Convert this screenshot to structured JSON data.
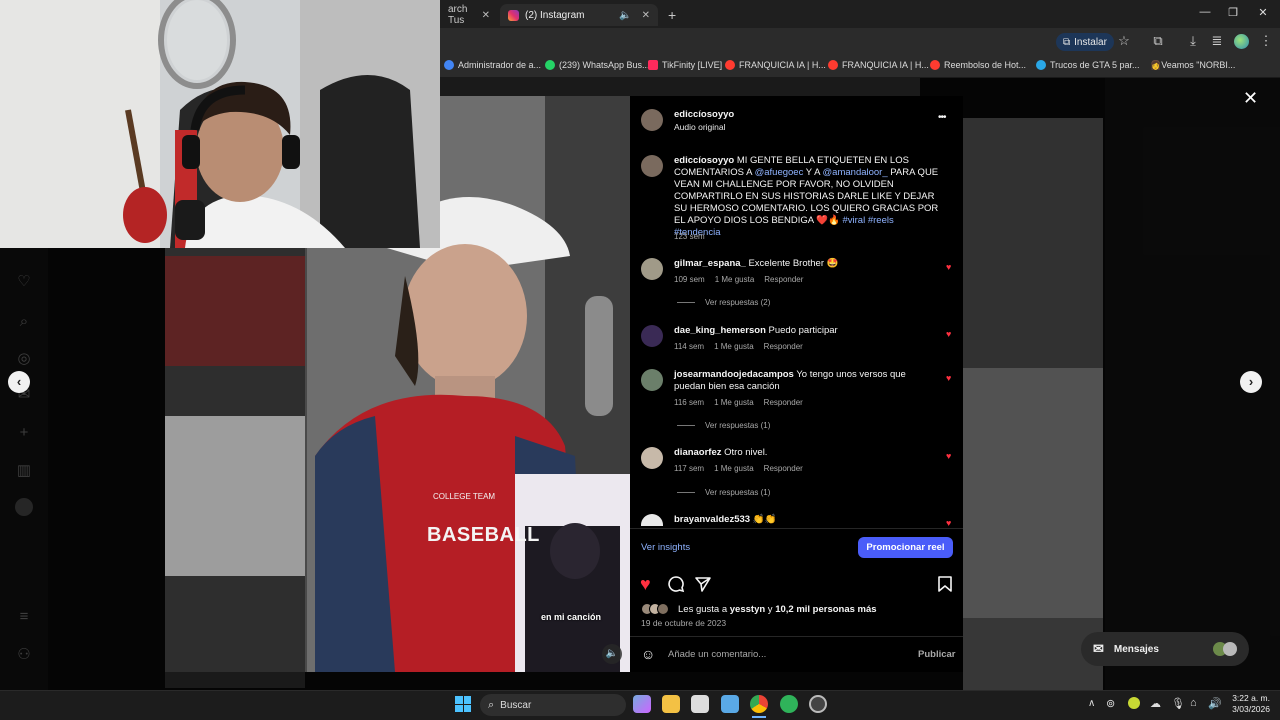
{
  "browser": {
    "tabs": [
      {
        "label": "arch Tus ",
        "active": false
      },
      {
        "label": "(2) Instagram",
        "active": true
      }
    ],
    "new_tab": "+",
    "install_label": "Instalar",
    "bookmarks": [
      {
        "label": "Administrador de a...",
        "color": "#4285f4"
      },
      {
        "label": "(239) WhatsApp Bus...",
        "color": "#25d366"
      },
      {
        "label": "TikFinity [LIVE]",
        "color": "#ff2a5c"
      },
      {
        "label": "FRANQUICIA IA | H...",
        "color": "#ff3b30"
      },
      {
        "label": "FRANQUICIA IA | H...",
        "color": "#ff3b30"
      },
      {
        "label": "Reembolso de Hot...",
        "color": "#ff3b30"
      },
      {
        "label": "Trucos de GTA 5 par...",
        "color": "#2aa7e6"
      },
      {
        "label": "👩Veamos \"NORBI...",
        "color": "#e6a23c"
      }
    ]
  },
  "post": {
    "author": "ediccíosoyyo",
    "audio": "Audio original",
    "more_icon": "•••",
    "caption_user": "ediccíosoyyo",
    "caption": [
      {
        "t": "MI GENTE BELLA ETIQUETEN EN LOS COMENTARIOS A ",
        "link": false
      },
      {
        "t": "@afuegoec",
        "link": true
      },
      {
        "t": " Y A ",
        "link": false
      },
      {
        "t": "@amandaloor_",
        "link": true
      },
      {
        "t": " PARA QUE VEAN MI CHALLENGE POR FAVOR, NO OLVIDEN COMPARTIRLO EN SUS HISTORIAS DARLE LIKE Y DEJAR SU HERMOSO COMENTARIO. LOS QUIERO GRACIAS POR EL APOYO DIOS LOS BENDIGA ❤️🔥 ",
        "link": false
      },
      {
        "t": "#viral #reels #tendencia",
        "link": true
      }
    ],
    "caption_time": "123 sem",
    "comments": [
      {
        "user": "gilmar_espana_",
        "text": "Excelente Brother 🤩",
        "time": "109 sem",
        "likes": "1 Me gusta",
        "reply": "Responder",
        "replies": "Ver respuestas (2)"
      },
      {
        "user": "dae_king_hemerson",
        "text": "Puedo participar",
        "time": "114 sem",
        "likes": "1 Me gusta",
        "reply": "Responder",
        "replies": ""
      },
      {
        "user": "josearmandoojedacampos",
        "text": "Yo tengo unos versos que puedan bien esa canción",
        "time": "116 sem",
        "likes": "1 Me gusta",
        "reply": "Responder",
        "replies": "Ver respuestas (1)"
      },
      {
        "user": "dianaorfez",
        "text": "Otro nivel.",
        "time": "117 sem",
        "likes": "1 Me gusta",
        "reply": "Responder",
        "replies": "Ver respuestas (1)"
      },
      {
        "user": "brayanvaldez533",
        "text": "👏👏",
        "time": "",
        "likes": "",
        "reply": "",
        "replies": ""
      }
    ],
    "insights": "Ver insights",
    "promote": "Promocionar reel",
    "likes_text_prefix": "Les gusta a ",
    "likes_user": "yesstyn",
    "likes_text_mid": " y ",
    "likes_count": "10,2 mil personas más",
    "date": "19 de octubre de 2023",
    "comment_placeholder": "Añade un comentario...",
    "publish": "Publicar"
  },
  "video": {
    "inset_caption": "en mi canción",
    "jacket_text": "BASEBALL",
    "jacket_sub": "COLLEGE TEAM"
  },
  "messages_label": "Mensajes",
  "taskbar": {
    "search": "Buscar",
    "time": "3:22 a. m.",
    "date": "3/03/2026"
  }
}
